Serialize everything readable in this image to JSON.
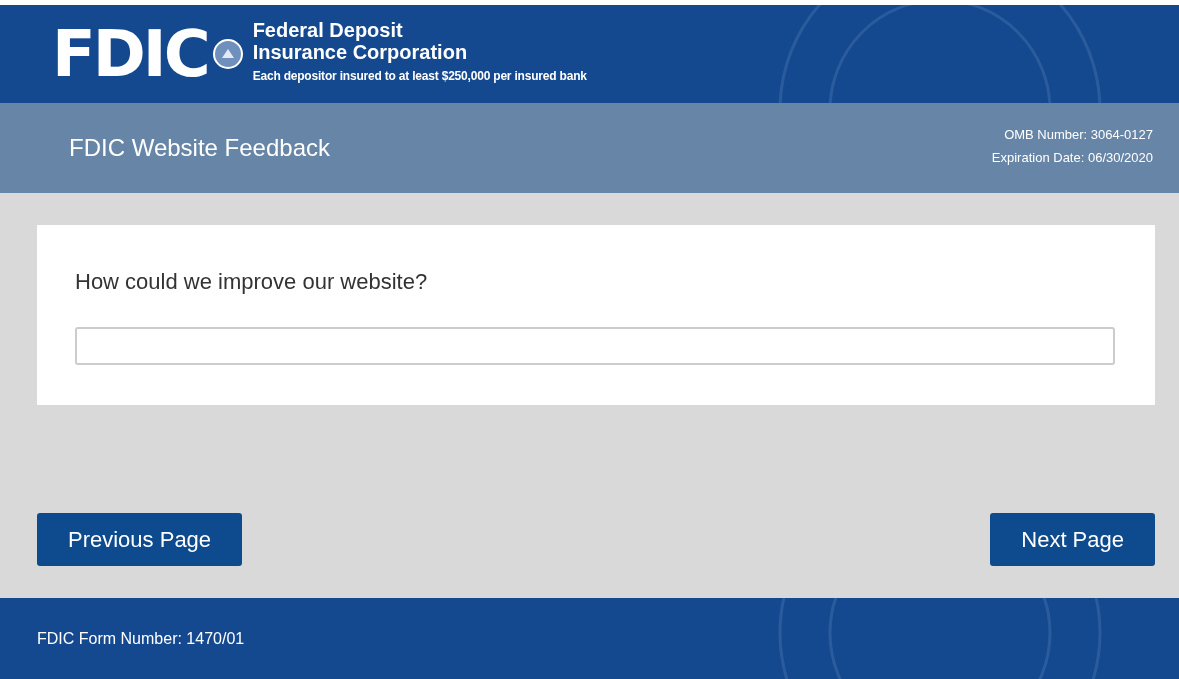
{
  "header": {
    "logo": "FDIC",
    "name_lines": [
      "Federal Deposit",
      "Insurance Corporation"
    ],
    "tagline": "Each depositor insured to at least $250,000 per insured bank"
  },
  "title_bar": {
    "title": "FDIC Website Feedback",
    "meta": [
      "OMB Number: 3064-0127",
      "Expiration Date: 06/30/2020"
    ]
  },
  "question": {
    "label": "How could we improve our website?"
  },
  "buttons": [
    {
      "label": "Previous Page",
      "kind": "previous"
    },
    {
      "label": "Next Page",
      "kind": "next"
    }
  ],
  "footer": {
    "text": "FDIC Form Number: 1470/01"
  }
}
